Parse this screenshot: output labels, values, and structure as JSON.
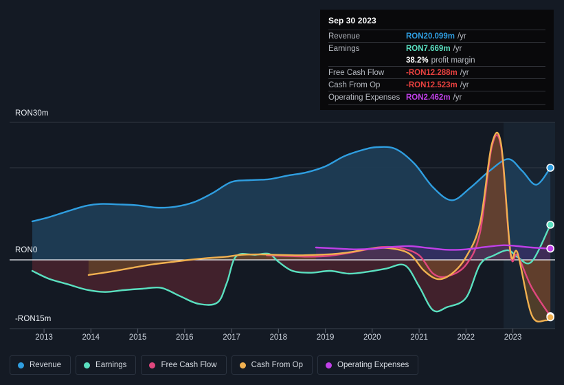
{
  "background": "#141a24",
  "tooltip": {
    "date": "Sep 30 2023",
    "rows": [
      {
        "label": "Revenue",
        "value": "RON20.099m",
        "unit": "/yr",
        "color": "#2f9ee0"
      },
      {
        "label": "Earnings",
        "value": "RON7.669m",
        "unit": "/yr",
        "color": "#5ae0c0"
      },
      {
        "label": "",
        "value": "38.2%",
        "unit": "profit margin",
        "color": "#ffffff"
      },
      {
        "label": "Free Cash Flow",
        "value": "-RON12.288m",
        "unit": "/yr",
        "color": "#e8413f"
      },
      {
        "label": "Cash From Op",
        "value": "-RON12.523m",
        "unit": "/yr",
        "color": "#e8413f"
      },
      {
        "label": "Operating Expenses",
        "value": "RON2.462m",
        "unit": "/yr",
        "color": "#c040e8"
      }
    ]
  },
  "legend": {
    "items": [
      {
        "label": "Revenue",
        "color": "#2f9ee0"
      },
      {
        "label": "Earnings",
        "color": "#5ae0c0"
      },
      {
        "label": "Free Cash Flow",
        "color": "#e0477e"
      },
      {
        "label": "Cash From Op",
        "color": "#f0b050"
      },
      {
        "label": "Operating Expenses",
        "color": "#c040e8"
      }
    ]
  },
  "axes": {
    "y_top_label": "RON30m",
    "y_zero_label": "RON0",
    "y_bottom_label": "-RON15m",
    "x_labels": [
      "2013",
      "2014",
      "2015",
      "2016",
      "2017",
      "2018",
      "2019",
      "2020",
      "2021",
      "2022",
      "2023"
    ]
  },
  "chart_data": {
    "type": "area",
    "title": "",
    "xlabel": "",
    "ylabel": "RON",
    "currency": "RON",
    "units": "millions",
    "ylim": [
      -15,
      30
    ],
    "y_ticks": [
      30,
      20,
      10,
      0,
      -10,
      -15
    ],
    "y_tick_labels": [
      "RON30m",
      "",
      "",
      "RON0",
      "",
      "-RON15m"
    ],
    "grid": true,
    "legend_position": "bottom",
    "x": [
      "2013",
      "2014",
      "2015",
      "2016",
      "2017",
      "2018",
      "2019",
      "2020",
      "2021",
      "2022",
      "2023"
    ],
    "xlim": [
      2012.75,
      2023.9
    ],
    "series": [
      {
        "name": "Revenue",
        "color": "#2f9ee0",
        "fill": "#1d3c55",
        "x": [
          2012.75,
          2013.1,
          2013.5,
          2013.9,
          2014.2,
          2014.6,
          2015.0,
          2015.4,
          2015.8,
          2016.2,
          2016.6,
          2017.0,
          2017.4,
          2017.8,
          2018.2,
          2018.6,
          2019.0,
          2019.4,
          2019.8,
          2020.1,
          2020.5,
          2020.9,
          2021.3,
          2021.7,
          2022.1,
          2022.5,
          2022.9,
          2023.2,
          2023.5,
          2023.8
        ],
        "values": [
          8.4,
          9.3,
          10.6,
          11.8,
          12.2,
          12.1,
          11.9,
          11.4,
          11.6,
          12.6,
          14.6,
          17.0,
          17.4,
          17.6,
          18.4,
          19.1,
          20.4,
          22.6,
          24.0,
          24.6,
          24.2,
          21.0,
          15.8,
          13.0,
          15.8,
          19.4,
          22.0,
          19.4,
          16.4,
          20.1
        ],
        "end_value": 20.099,
        "end_label": "RON20.099m"
      },
      {
        "name": "Earnings",
        "color": "#5ae0c0",
        "fill": "#5a2630",
        "x": [
          2012.75,
          2013.1,
          2013.5,
          2013.9,
          2014.3,
          2014.7,
          2015.1,
          2015.5,
          2015.9,
          2016.3,
          2016.7,
          2016.9,
          2017.1,
          2017.5,
          2017.8,
          2018.0,
          2018.3,
          2018.7,
          2019.1,
          2019.5,
          2019.9,
          2020.3,
          2020.7,
          2021.0,
          2021.3,
          2021.6,
          2022.0,
          2022.3,
          2022.6,
          2022.9,
          2023.1,
          2023.4,
          2023.8
        ],
        "values": [
          -2.4,
          -4.1,
          -5.3,
          -6.5,
          -7.0,
          -6.6,
          -6.3,
          -6.1,
          -7.9,
          -9.6,
          -9.3,
          -5.0,
          0.8,
          1.1,
          1.3,
          -0.4,
          -2.4,
          -2.8,
          -2.4,
          -3.0,
          -2.6,
          -1.9,
          -1.2,
          -5.8,
          -11.0,
          -10.3,
          -8.3,
          -1.0,
          1.0,
          2.1,
          0.6,
          -0.4,
          7.669
        ],
        "end_value": 7.669,
        "end_label": "RON7.669m"
      },
      {
        "name": "Free Cash Flow",
        "color": "#e0477e",
        "fill": "#6a2838",
        "x": [
          2017.75,
          2018.0,
          2018.3,
          2018.7,
          2019.1,
          2019.5,
          2019.9,
          2020.2,
          2020.6,
          2021.0,
          2021.3,
          2021.6,
          2022.0,
          2022.3,
          2022.55,
          2022.75,
          2022.95,
          2023.1,
          2023.4,
          2023.8
        ],
        "values": [
          1.0,
          0.9,
          0.8,
          0.7,
          0.9,
          1.5,
          2.3,
          2.8,
          2.6,
          1.0,
          -3.0,
          -3.6,
          -1.1,
          6.0,
          24.6,
          24.6,
          1.2,
          1.0,
          -6.0,
          -12.288
        ],
        "end_value": -12.288,
        "end_label": "-RON12.288m"
      },
      {
        "name": "Cash From Op",
        "color": "#f0b050",
        "fill": "#6a4a28",
        "x": [
          2013.95,
          2014.4,
          2014.9,
          2015.3,
          2015.7,
          2016.1,
          2016.5,
          2016.9,
          2017.2,
          2017.6,
          2018.0,
          2018.4,
          2018.8,
          2019.2,
          2019.6,
          2020.0,
          2020.4,
          2020.8,
          2021.1,
          2021.4,
          2021.7,
          2022.0,
          2022.3,
          2022.55,
          2022.75,
          2022.95,
          2023.1,
          2023.4,
          2023.7,
          2023.8
        ],
        "values": [
          -3.3,
          -2.6,
          -1.7,
          -1.0,
          -0.5,
          0.0,
          0.4,
          0.7,
          1.1,
          1.2,
          1.1,
          1.0,
          1.1,
          1.3,
          1.8,
          2.5,
          2.5,
          1.3,
          -2.3,
          -4.2,
          -3.0,
          0.6,
          8.0,
          25.2,
          25.2,
          1.6,
          1.5,
          -12.0,
          -13.2,
          -12.523
        ],
        "end_value": -12.523,
        "end_label": "-RON12.523m"
      },
      {
        "name": "Operating Expenses",
        "color": "#c040e8",
        "fill": "#3c2a66",
        "x": [
          2018.8,
          2019.2,
          2019.6,
          2020.0,
          2020.4,
          2020.8,
          2021.2,
          2021.6,
          2022.0,
          2022.4,
          2022.8,
          2023.1,
          2023.4,
          2023.8
        ],
        "values": [
          2.7,
          2.5,
          2.3,
          2.4,
          2.8,
          3.0,
          2.6,
          2.2,
          2.3,
          2.8,
          3.2,
          3.0,
          2.7,
          2.462
        ],
        "end_value": 2.462,
        "end_label": "RON2.462m"
      }
    ],
    "highlight_band": {
      "from_x": 2022.6,
      "to_x": 2023.9,
      "note": "shaded recent period"
    }
  }
}
